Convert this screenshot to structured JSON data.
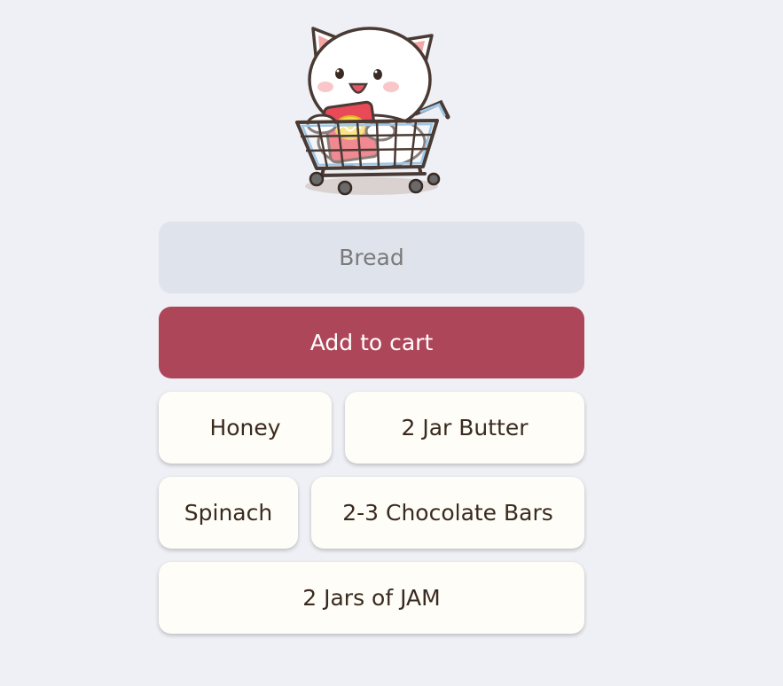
{
  "colors": {
    "background": "#eef0f5",
    "input_bg": "#dfe3ec",
    "accent": "#ad4659",
    "item_bg": "#fefdf7",
    "item_text": "#3a2a1f"
  },
  "mascot": {
    "icon": "cat-in-shopping-cart-icon"
  },
  "input": {
    "placeholder": "Bread",
    "value": ""
  },
  "add_button": {
    "label": "Add to cart"
  },
  "cart_items": [
    "Honey",
    "2 Jar Butter",
    "Spinach",
    "2-3 Chocolate Bars",
    "2 Jars of JAM"
  ]
}
